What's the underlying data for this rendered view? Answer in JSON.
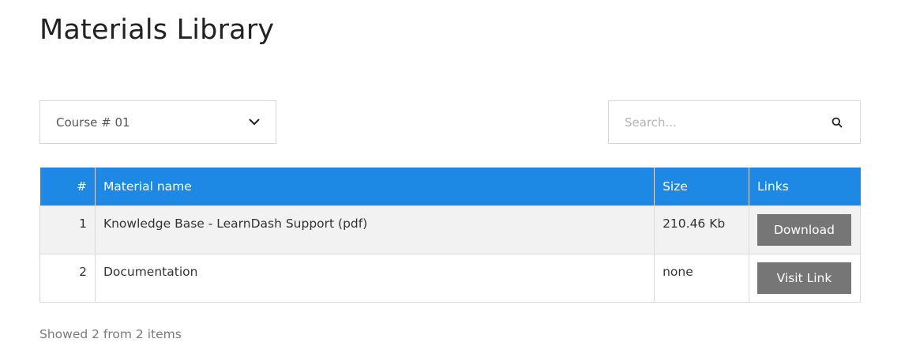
{
  "page": {
    "title": "Materials Library"
  },
  "filter": {
    "selected_course": "Course # 01"
  },
  "search": {
    "placeholder": "Search...",
    "value": ""
  },
  "table": {
    "headers": {
      "num": "#",
      "name": "Material name",
      "size": "Size",
      "links": "Links"
    },
    "rows": [
      {
        "num": "1",
        "name": "Knowledge Base - LearnDash Support (pdf)",
        "size": "210.46 Kb",
        "action": "Download"
      },
      {
        "num": "2",
        "name": "Documentation",
        "size": "none",
        "action": "Visit Link"
      }
    ]
  },
  "footer": {
    "count_text": "Showed 2 from 2 items"
  },
  "colors": {
    "header_bg": "#1e88e5",
    "button_bg": "#767676",
    "odd_row_bg": "#f2f2f2"
  },
  "icons": {
    "select": "chevron-down-icon",
    "search": "search-icon"
  }
}
